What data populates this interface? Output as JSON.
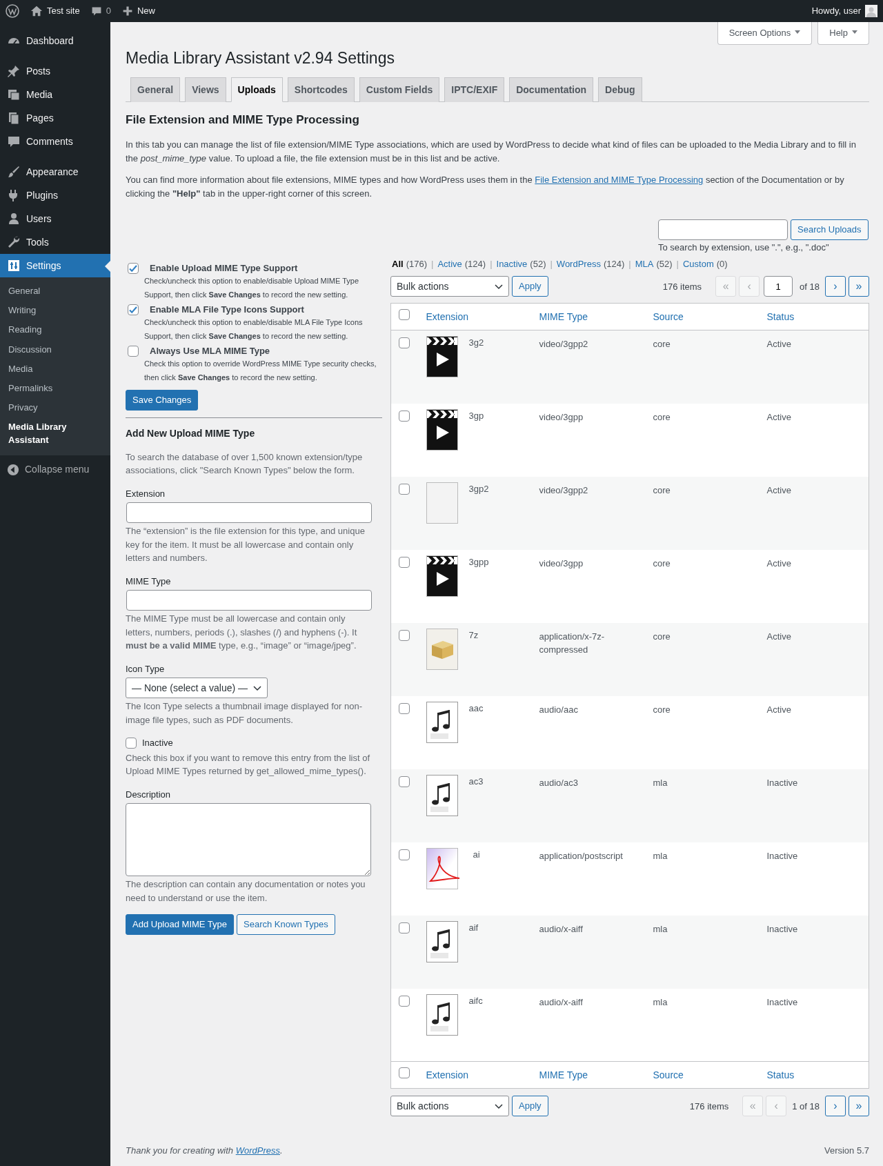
{
  "admin_bar": {
    "site": "Test site",
    "comments": "0",
    "new": "New",
    "greeting": "Howdy, user"
  },
  "sidebar": {
    "items": [
      {
        "label": "Dashboard",
        "selected": false
      },
      {
        "label": "Posts",
        "selected": false
      },
      {
        "label": "Media",
        "selected": false
      },
      {
        "label": "Pages",
        "selected": false
      },
      {
        "label": "Comments",
        "selected": false
      },
      {
        "label": "Appearance",
        "selected": false
      },
      {
        "label": "Plugins",
        "selected": false
      },
      {
        "label": "Users",
        "selected": false
      },
      {
        "label": "Tools",
        "selected": false
      },
      {
        "label": "Settings",
        "selected": true
      }
    ],
    "submenu": [
      {
        "label": "General",
        "selected": false
      },
      {
        "label": "Writing",
        "selected": false
      },
      {
        "label": "Reading",
        "selected": false
      },
      {
        "label": "Discussion",
        "selected": false
      },
      {
        "label": "Media",
        "selected": false
      },
      {
        "label": "Permalinks",
        "selected": false
      },
      {
        "label": "Privacy",
        "selected": false
      },
      {
        "label": "Media Library Assistant",
        "selected": true
      }
    ],
    "collapse": "Collapse menu"
  },
  "screen_meta": [
    "Screen Options",
    "Help"
  ],
  "title": "Media Library Assistant v2.94 Settings",
  "tabs": [
    {
      "label": "General",
      "selected": false
    },
    {
      "label": "Views",
      "selected": false
    },
    {
      "label": "Uploads",
      "selected": true
    },
    {
      "label": "Shortcodes",
      "selected": false
    },
    {
      "label": "Custom Fields",
      "selected": false
    },
    {
      "label": "IPTC/EXIF",
      "selected": false
    },
    {
      "label": "Documentation",
      "selected": false
    },
    {
      "label": "Debug",
      "selected": false
    }
  ],
  "section_title": "File Extension and MIME Type Processing",
  "intro": "In this tab you can manage the list of file extension/MIME Type associations, which are used by WordPress to decide what kind of files can be uploaded to the Media Library and to fill in the *post_mime_type* value. To upload a file, the file extension must be in this list and be active.",
  "more_info": {
    "before": "You can find more information about file extensions, MIME types and how WordPress uses them in the ",
    "link": "File Extension and MIME Type Processing",
    "after": " section of the Documentation or by clicking the **\"Help\"** tab in the upper-right corner of this screen."
  },
  "search": {
    "button": "Search Uploads",
    "hint": "To search by extension, use \".\", e.g., \".doc\""
  },
  "options": [
    {
      "label": "Enable Upload MIME Type Support",
      "checked": true,
      "help": "Check/uncheck this option to enable/disable Upload MIME Type Support, then click **Save Changes** to record the new setting."
    },
    {
      "label": "Enable MLA File Type Icons Support",
      "checked": true,
      "help": "Check/uncheck this option to enable/disable MLA File Type Icons Support, then click **Save Changes** to record the new setting."
    },
    {
      "label": "Always Use MLA MIME Type",
      "checked": false,
      "help": "Check this option to override WordPress MIME Type security checks, then click **Save Changes** to record the new setting."
    }
  ],
  "save_button": "Save Changes",
  "add_form": {
    "title": "Add New Upload MIME Type",
    "intro": "To search the database of over 1,500 known extension/type associations, click \"Search Known Types\" below the form.",
    "fields": [
      {
        "kind": "text",
        "label": "Extension",
        "help": "The “extension” is the file extension for this type, and unique key for the item. It must be all lowercase and contain only letters and numbers."
      },
      {
        "kind": "text",
        "label": "MIME Type",
        "help": "The MIME Type must be all lowercase and contain only letters, numbers, periods (.), slashes (/) and hyphens (-). It **must be a valid MIME** type, e.g., “image” or “image/jpeg”."
      },
      {
        "kind": "select",
        "label": "Icon Type",
        "value": "— None (select a value) —",
        "help": "The Icon Type selects a thumbnail image displayed for non-image file types, such as PDF documents."
      },
      {
        "kind": "checkbox",
        "label": "Inactive",
        "checked": false,
        "help": "Check this box if you want to remove this entry from the list of Upload MIME Types returned by get_allowed_mime_types()."
      },
      {
        "kind": "textarea",
        "label": "Description",
        "help": "The description can contain any documentation or notes you need to understand or use the item."
      }
    ],
    "buttons": [
      "Add Upload MIME Type",
      "Search Known Types"
    ]
  },
  "filters": [
    {
      "label": "All",
      "count": "(176)",
      "selected": true
    },
    {
      "separator": "|",
      "label": "Active",
      "count": "(124)",
      "selected": false
    },
    {
      "separator": "|",
      "label": "Inactive",
      "count": "(52)",
      "selected": false
    },
    {
      "separator": "|",
      "label": "WordPress",
      "count": "(124)",
      "selected": false
    },
    {
      "separator": "|",
      "label": "MLA",
      "count": "(52)",
      "selected": false
    },
    {
      "separator": "|",
      "label": "Custom",
      "count": "(0)",
      "selected": false
    }
  ],
  "top_nav": {
    "bulk": "Bulk actions",
    "apply": "Apply",
    "items": "176 items",
    "page": "1",
    "of": "of 18",
    "pager": [
      {
        "label": "«",
        "disabled": true
      },
      {
        "label": "‹",
        "disabled": true
      },
      {
        "label": "›",
        "disabled": false
      },
      {
        "label": "»",
        "disabled": false
      }
    ]
  },
  "table": {
    "columns": [
      "Extension",
      "MIME Type",
      "Source",
      "Status"
    ],
    "header_checked": false,
    "rows": [
      {
        "kind": "video",
        "extension": "3g2",
        "mime": "video/3gpp2",
        "source": "core",
        "status": "Active",
        "checked": false
      },
      {
        "kind": "video",
        "extension": "3gp",
        "mime": "video/3gpp",
        "source": "core",
        "status": "Active",
        "checked": false
      },
      {
        "kind": "blank",
        "extension": "3gp2",
        "mime": "video/3gpp2",
        "source": "core",
        "status": "Active",
        "checked": false
      },
      {
        "kind": "video",
        "extension": "3gpp",
        "mime": "video/3gpp",
        "source": "core",
        "status": "Active",
        "checked": false
      },
      {
        "kind": "archive",
        "extension": "7z",
        "mime": "application/x-7z-compressed",
        "source": "core",
        "status": "Active",
        "checked": false
      },
      {
        "kind": "audio",
        "extension": "aac",
        "mime": "audio/aac",
        "source": "core",
        "status": "Active",
        "checked": false
      },
      {
        "kind": "audio",
        "extension": "ac3",
        "mime": "audio/ac3",
        "source": "mla",
        "status": "Inactive",
        "checked": false
      },
      {
        "kind": "pdf",
        "extension": "ai",
        "mime": "application/postscript",
        "source": "mla",
        "status": "Inactive",
        "checked": false
      },
      {
        "kind": "audio",
        "extension": "aif",
        "mime": "audio/x-aiff",
        "source": "mla",
        "status": "Inactive",
        "checked": false
      },
      {
        "kind": "audio",
        "extension": "aifc",
        "mime": "audio/x-aiff",
        "source": "mla",
        "status": "Inactive",
        "checked": false
      }
    ],
    "footer_columns": [
      "Extension",
      "MIME Type",
      "Source",
      "Status"
    ],
    "footer_checked": false
  },
  "bottom_nav": {
    "bulk": "Bulk actions",
    "apply": "Apply",
    "items": "176 items",
    "page_text": "1 of 18",
    "pager": [
      {
        "label": "«",
        "disabled": true
      },
      {
        "label": "‹",
        "disabled": true
      },
      {
        "label": "›",
        "disabled": false
      },
      {
        "label": "»",
        "disabled": false
      }
    ]
  },
  "footer": {
    "before": "Thank you for creating with ",
    "link": "WordPress",
    "after": ".",
    "version": "Version 5.7"
  }
}
